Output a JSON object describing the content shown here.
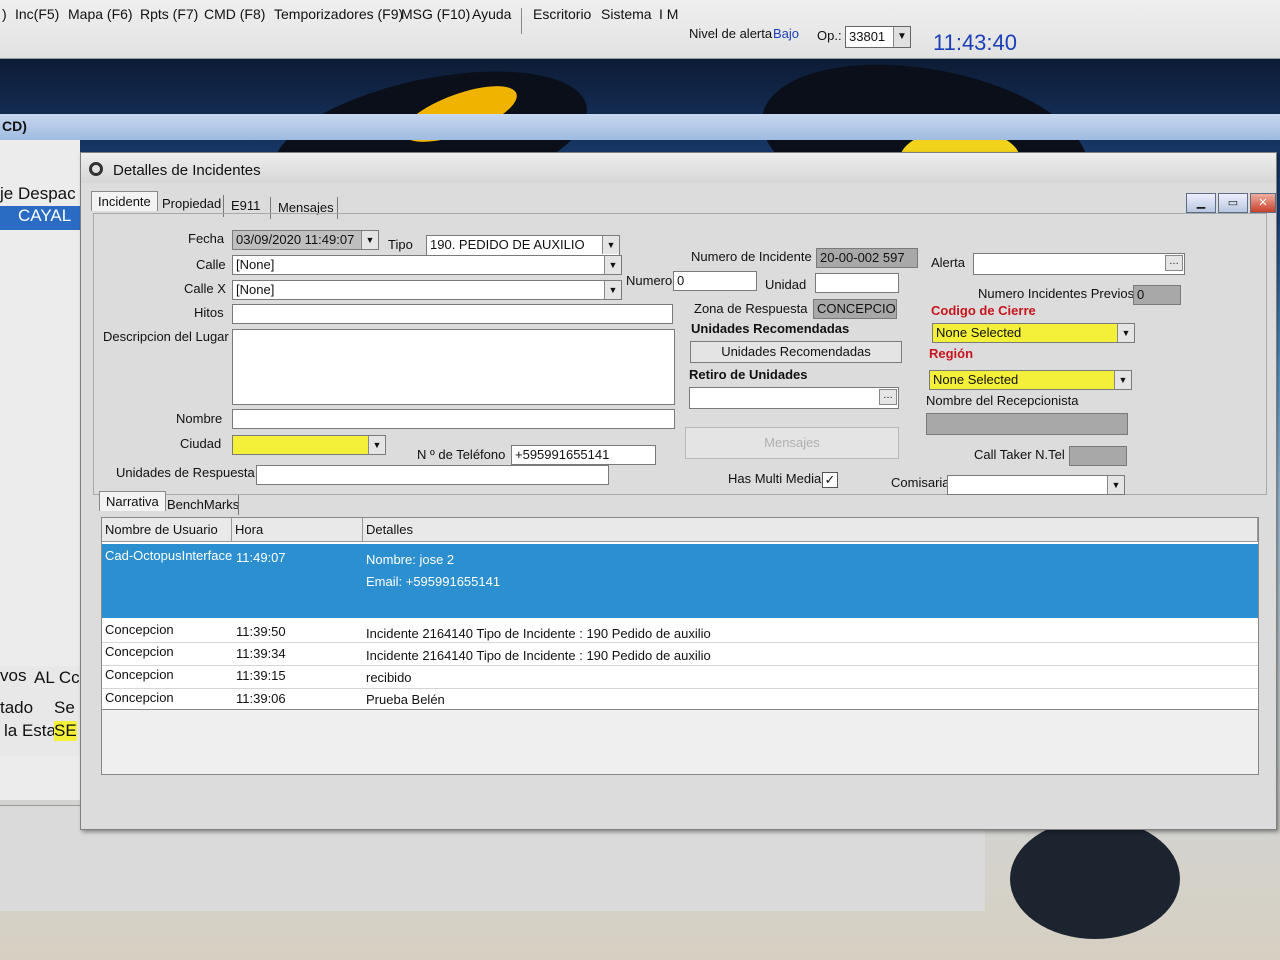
{
  "menubar": {
    "items": [
      ")",
      "Inc(F5)",
      "Mapa (F6)",
      "Rpts (F7)",
      "CMD (F8)",
      "Temporizadores (F9)",
      "MSG (F10)",
      "Ayuda",
      "Escritorio",
      "Sistema",
      "I M"
    ],
    "alert_label": "Nivel de alerta",
    "alert_value": "Bajo",
    "op_label": "Op.:",
    "op_value": "33801",
    "clock": "11:43:40",
    "accent_color": "#1a3fb8"
  },
  "background_app": {
    "title": "CD)",
    "col_prefix": "je",
    "col_header": "Despac",
    "selected_item": "CAYAL",
    "bottom_labels": [
      "vos",
      "AL Cc",
      "tado",
      "Se",
      "la Esta",
      "SE"
    ]
  },
  "dialog": {
    "title": "Detalles de Incidentes",
    "tabs": [
      "Incidente",
      "Propiedad",
      "E911",
      "Mensajes"
    ],
    "active_tab": "Incidente",
    "fecha_label": "Fecha",
    "fecha_value": "03/09/2020 11:49:07",
    "tipo_label": "Tipo",
    "tipo_value": "190. PEDIDO DE AUXILIO",
    "calle_label": "Calle",
    "calle_value": "[None]",
    "numero_label": "Numero",
    "numero_value": "0",
    "callex_label": "Calle X",
    "callex_value": "[None]",
    "hitos_label": "Hitos",
    "descripcion_label": "Descripcion del Lugar",
    "nombre_label": "Nombre",
    "ciudad_label": "Ciudad",
    "telefono_label": "N º de Teléfono",
    "telefono_value": "+595991655141",
    "unidades_respuesta_label": "Unidades de Respuesta",
    "numero_incidente_label": "Numero de Incidente",
    "numero_incidente_value": "20-00-002 597",
    "unidad_label": "Unidad",
    "zona_label": "Zona de Respuesta",
    "zona_value": "CONCEPCION",
    "unidades_recomendadas_heading": "Unidades Recomendadas",
    "unidades_recomendadas_button": "Unidades Recomendadas",
    "retiro_heading": "Retiro de Unidades",
    "mensajes_button": "Mensajes",
    "multimedia_label": "Has Multi Media",
    "multimedia_checked": "✓",
    "alerta_label": "Alerta",
    "previos_label": "Numero Incidentes Previos",
    "previos_value": "0",
    "codigo_cierre_label": "Codigo de Cierre",
    "codigo_cierre_value": "None Selected",
    "region_label": "Región",
    "region_value": "None Selected",
    "recepcionista_label": "Nombre del Recepcionista",
    "calltaker_label": "Call Taker N.Tel",
    "comisaria_label": "Comisaria",
    "highlight_color": "#f4f03a",
    "label_red": "#c8141e"
  },
  "narrative": {
    "tabs": [
      "Narrativa",
      "BenchMarks"
    ],
    "columns": [
      "Nombre de Usuario",
      "Hora",
      "Detalles"
    ],
    "selected_row": {
      "user": "Cad-OctopusInterface",
      "time": "11:49:07",
      "line1": "Nombre: jose 2",
      "line2": "Email: +595991655141"
    },
    "rows": [
      {
        "user": "Concepcion",
        "time": "11:39:50",
        "detail": "Incidente 2164140 Tipo de Incidente : 190 Pedido de auxilio"
      },
      {
        "user": "Concepcion",
        "time": "11:39:34",
        "detail": "Incidente 2164140 Tipo de Incidente : 190 Pedido de auxilio"
      },
      {
        "user": "Concepcion",
        "time": "11:39:15",
        "detail": "recibido"
      },
      {
        "user": "Concepcion",
        "time": "11:39:06",
        "detail": "Prueba Belén"
      }
    ],
    "selection_color": "#2b8fd0"
  }
}
